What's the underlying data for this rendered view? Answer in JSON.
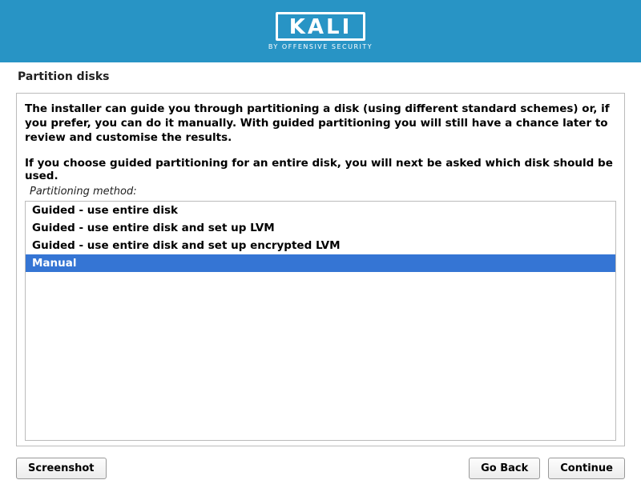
{
  "header": {
    "logo": "KALI",
    "subtitle": "BY OFFENSIVE SECURITY"
  },
  "page": {
    "title": "Partition disks",
    "description": "The installer can guide you through partitioning a disk (using different standard schemes) or, if you prefer, you can do it manually. With guided partitioning you will still have a chance later to review and customise the results.",
    "description2": "If you choose guided partitioning for an entire disk, you will next be asked which disk should be used.",
    "method_label": "Partitioning method:",
    "options": [
      "Guided - use entire disk",
      "Guided - use entire disk and set up LVM",
      "Guided - use entire disk and set up encrypted LVM",
      "Manual"
    ],
    "selected_index": 3
  },
  "buttons": {
    "screenshot": "Screenshot",
    "go_back": "Go Back",
    "continue": "Continue"
  }
}
